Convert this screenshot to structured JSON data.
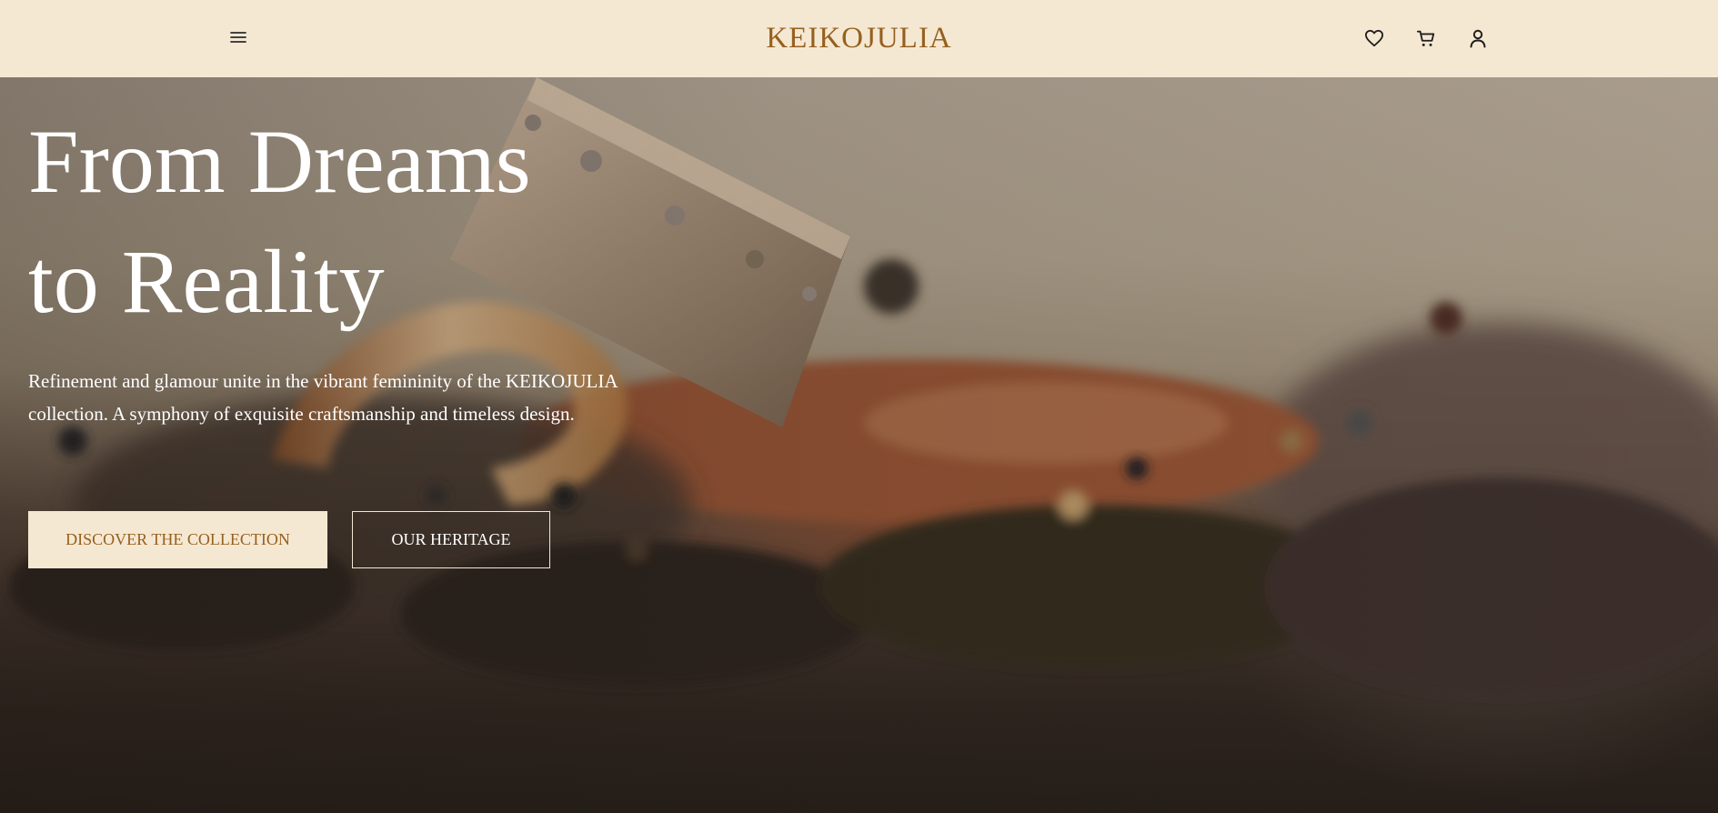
{
  "header": {
    "brand": "KEIKOJULIA",
    "menu_icon": "hamburger-menu-icon",
    "wishlist_icon": "heart-icon",
    "cart_icon": "shopping-cart-icon",
    "account_icon": "user-icon"
  },
  "hero": {
    "headline_line1": "From Dreams",
    "headline_line2": "to Reality",
    "subtext": "Refinement and glamour unite in the vibrant femininity of the KEIKOJULIA collection. A symphony of exquisite craftsmanship and timeless design.",
    "primary_button": "DISCOVER THE COLLECTION",
    "secondary_button": "OUR HERITAGE"
  },
  "colors": {
    "header_bg": "#f5e8d2",
    "brand_text": "#96601e",
    "hero_text": "#ffffff"
  }
}
